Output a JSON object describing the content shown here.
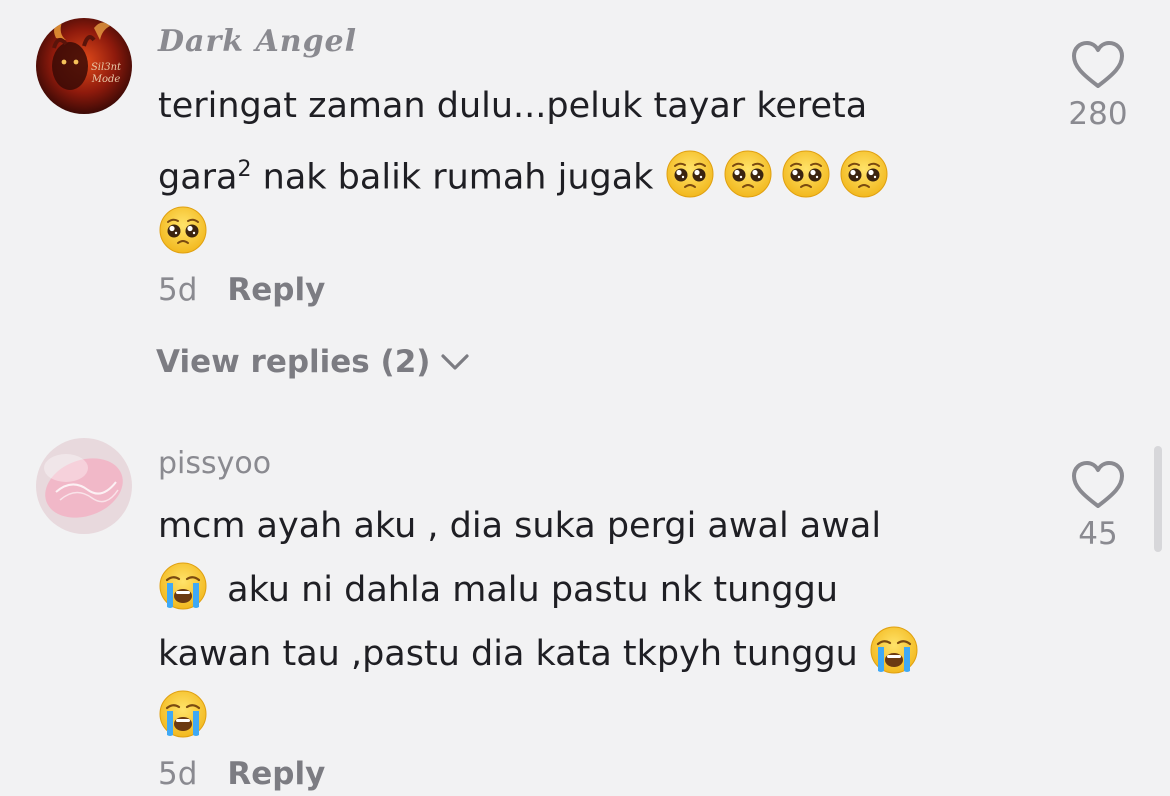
{
  "comments": [
    {
      "username": "Dark Angel",
      "avatar_text": [
        "Sil3nt",
        "Mode"
      ],
      "text_lines": [
        "teringat zaman dulu...peluk tayar kereta",
        "nak balik rumah jugak",
        ""
      ],
      "text_prefix_line2": "gara",
      "superscript": "2",
      "emoji": "pleading-face",
      "age": "5d",
      "reply_label": "Reply",
      "likes": "280",
      "view_replies": "View replies (2)"
    },
    {
      "username": "pissyoo",
      "text_lines": [
        "mcm ayah aku , dia suka pergi awal awal",
        "aku ni dahla malu pastu nk tunggu",
        "kawan tau ,pastu dia kata tkpyh tunggu"
      ],
      "emoji": "loudly-crying-face",
      "age": "5d",
      "reply_label": "Reply",
      "likes": "45"
    }
  ],
  "colors": {
    "background": "#f2f2f3",
    "text": "#1f1f24",
    "muted": "#8a8a90"
  },
  "icons": {
    "like": "heart-outline-icon",
    "expand": "chevron-down-icon"
  }
}
